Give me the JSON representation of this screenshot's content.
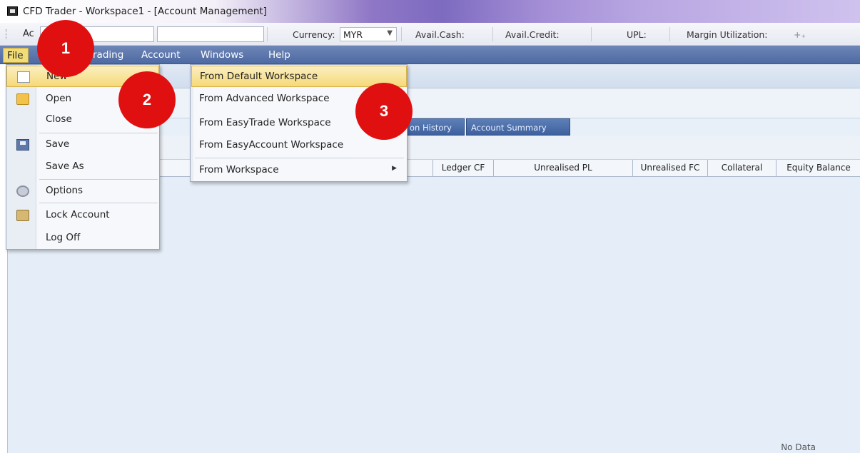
{
  "window": {
    "title": "CFD Trader - Workspace1 - [Account Management]"
  },
  "toolbar": {
    "account_label": "Ac",
    "currency_label": "Currency:",
    "currency_value": "MYR",
    "avail_cash_label": "Avail.Cash:",
    "avail_credit_label": "Avail.Credit:",
    "upl_label": "UPL:",
    "margin_label": "Margin Utilization:"
  },
  "menubar": {
    "items": [
      {
        "label": "File"
      },
      {
        "label": "rading"
      },
      {
        "label": "Account"
      },
      {
        "label": "Windows"
      },
      {
        "label": "Help"
      }
    ]
  },
  "file_menu": {
    "items": [
      {
        "label": "New",
        "icon": "new-document-icon"
      },
      {
        "label": "Open",
        "icon": "folder-open-icon"
      },
      {
        "label": "Close"
      },
      {
        "label": "Save",
        "icon": "save-disk-icon"
      },
      {
        "label": "Save As"
      },
      {
        "label": "Options",
        "icon": "gear-icon"
      },
      {
        "label": "Lock Account",
        "icon": "lock-icon"
      },
      {
        "label": "Log Off"
      }
    ]
  },
  "new_submenu": {
    "items": [
      {
        "label": "From Default Workspace"
      },
      {
        "label": "From Advanced Workspace"
      },
      {
        "label": "From EasyTrade Workspace"
      },
      {
        "label": "From EasyAccount Workspace"
      },
      {
        "label": "From Workspace"
      }
    ]
  },
  "tabs": [
    {
      "label": "on History"
    },
    {
      "label": "Account Summary"
    }
  ],
  "grid": {
    "columns": [
      "Ledger CF",
      "Unrealised PL",
      "Unrealised FC",
      "Collateral",
      "Equity Balance"
    ],
    "empty_text": "No Data"
  },
  "markers": [
    {
      "label": "1"
    },
    {
      "label": "2"
    },
    {
      "label": "3"
    }
  ]
}
